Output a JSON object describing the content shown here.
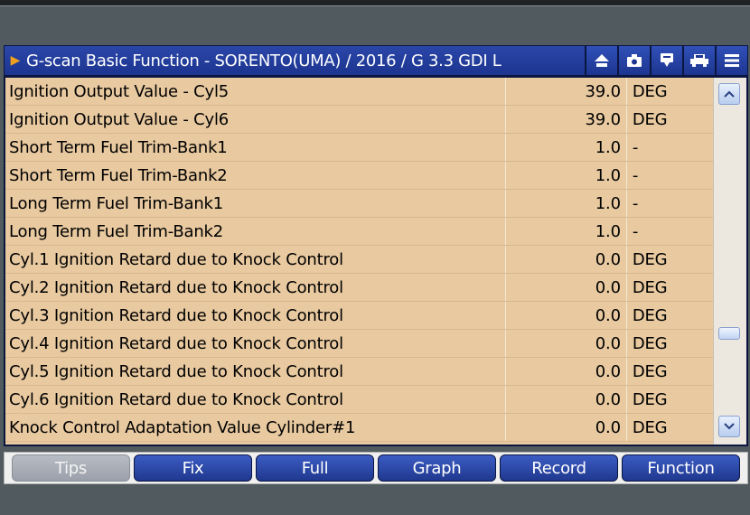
{
  "window": {
    "title": "G-scan Basic Function - SORENTO(UMA) / 2016 / G 3.3 GDI L",
    "toolbar_icons": [
      "home-icon",
      "camera-icon",
      "comment-icon",
      "vehicle-icon",
      "menu-icon"
    ]
  },
  "table": {
    "rows": [
      {
        "name": "Ignition Output Value - Cyl5",
        "value": "39.0",
        "unit": "DEG"
      },
      {
        "name": "Ignition Output Value - Cyl6",
        "value": "39.0",
        "unit": "DEG"
      },
      {
        "name": "Short Term Fuel Trim-Bank1",
        "value": "1.0",
        "unit": "-"
      },
      {
        "name": "Short Term Fuel Trim-Bank2",
        "value": "1.0",
        "unit": "-"
      },
      {
        "name": "Long Term Fuel Trim-Bank1",
        "value": "1.0",
        "unit": "-"
      },
      {
        "name": "Long Term Fuel Trim-Bank2",
        "value": "1.0",
        "unit": "-"
      },
      {
        "name": "Cyl.1 Ignition Retard due to Knock Control",
        "value": "0.0",
        "unit": "DEG"
      },
      {
        "name": "Cyl.2 Ignition Retard due to Knock Control",
        "value": "0.0",
        "unit": "DEG"
      },
      {
        "name": "Cyl.3 Ignition Retard due to Knock Control",
        "value": "0.0",
        "unit": "DEG"
      },
      {
        "name": "Cyl.4 Ignition Retard due to Knock Control",
        "value": "0.0",
        "unit": "DEG"
      },
      {
        "name": "Cyl.5 Ignition Retard due to Knock Control",
        "value": "0.0",
        "unit": "DEG"
      },
      {
        "name": "Cyl.6 Ignition Retard due to Knock Control",
        "value": "0.0",
        "unit": "DEG"
      },
      {
        "name": "Knock Control Adaptation Value Cylinder#1",
        "value": "0.0",
        "unit": "DEG"
      }
    ]
  },
  "bottom_buttons": {
    "tips": "Tips",
    "fix": "Fix",
    "full": "Full",
    "graph": "Graph",
    "record": "Record",
    "function": "Function"
  },
  "colors": {
    "title_bar": "#1d3590",
    "row_background": "#e8c9a0",
    "button": "#2a46a8",
    "disabled_button": "#a8adb6"
  }
}
